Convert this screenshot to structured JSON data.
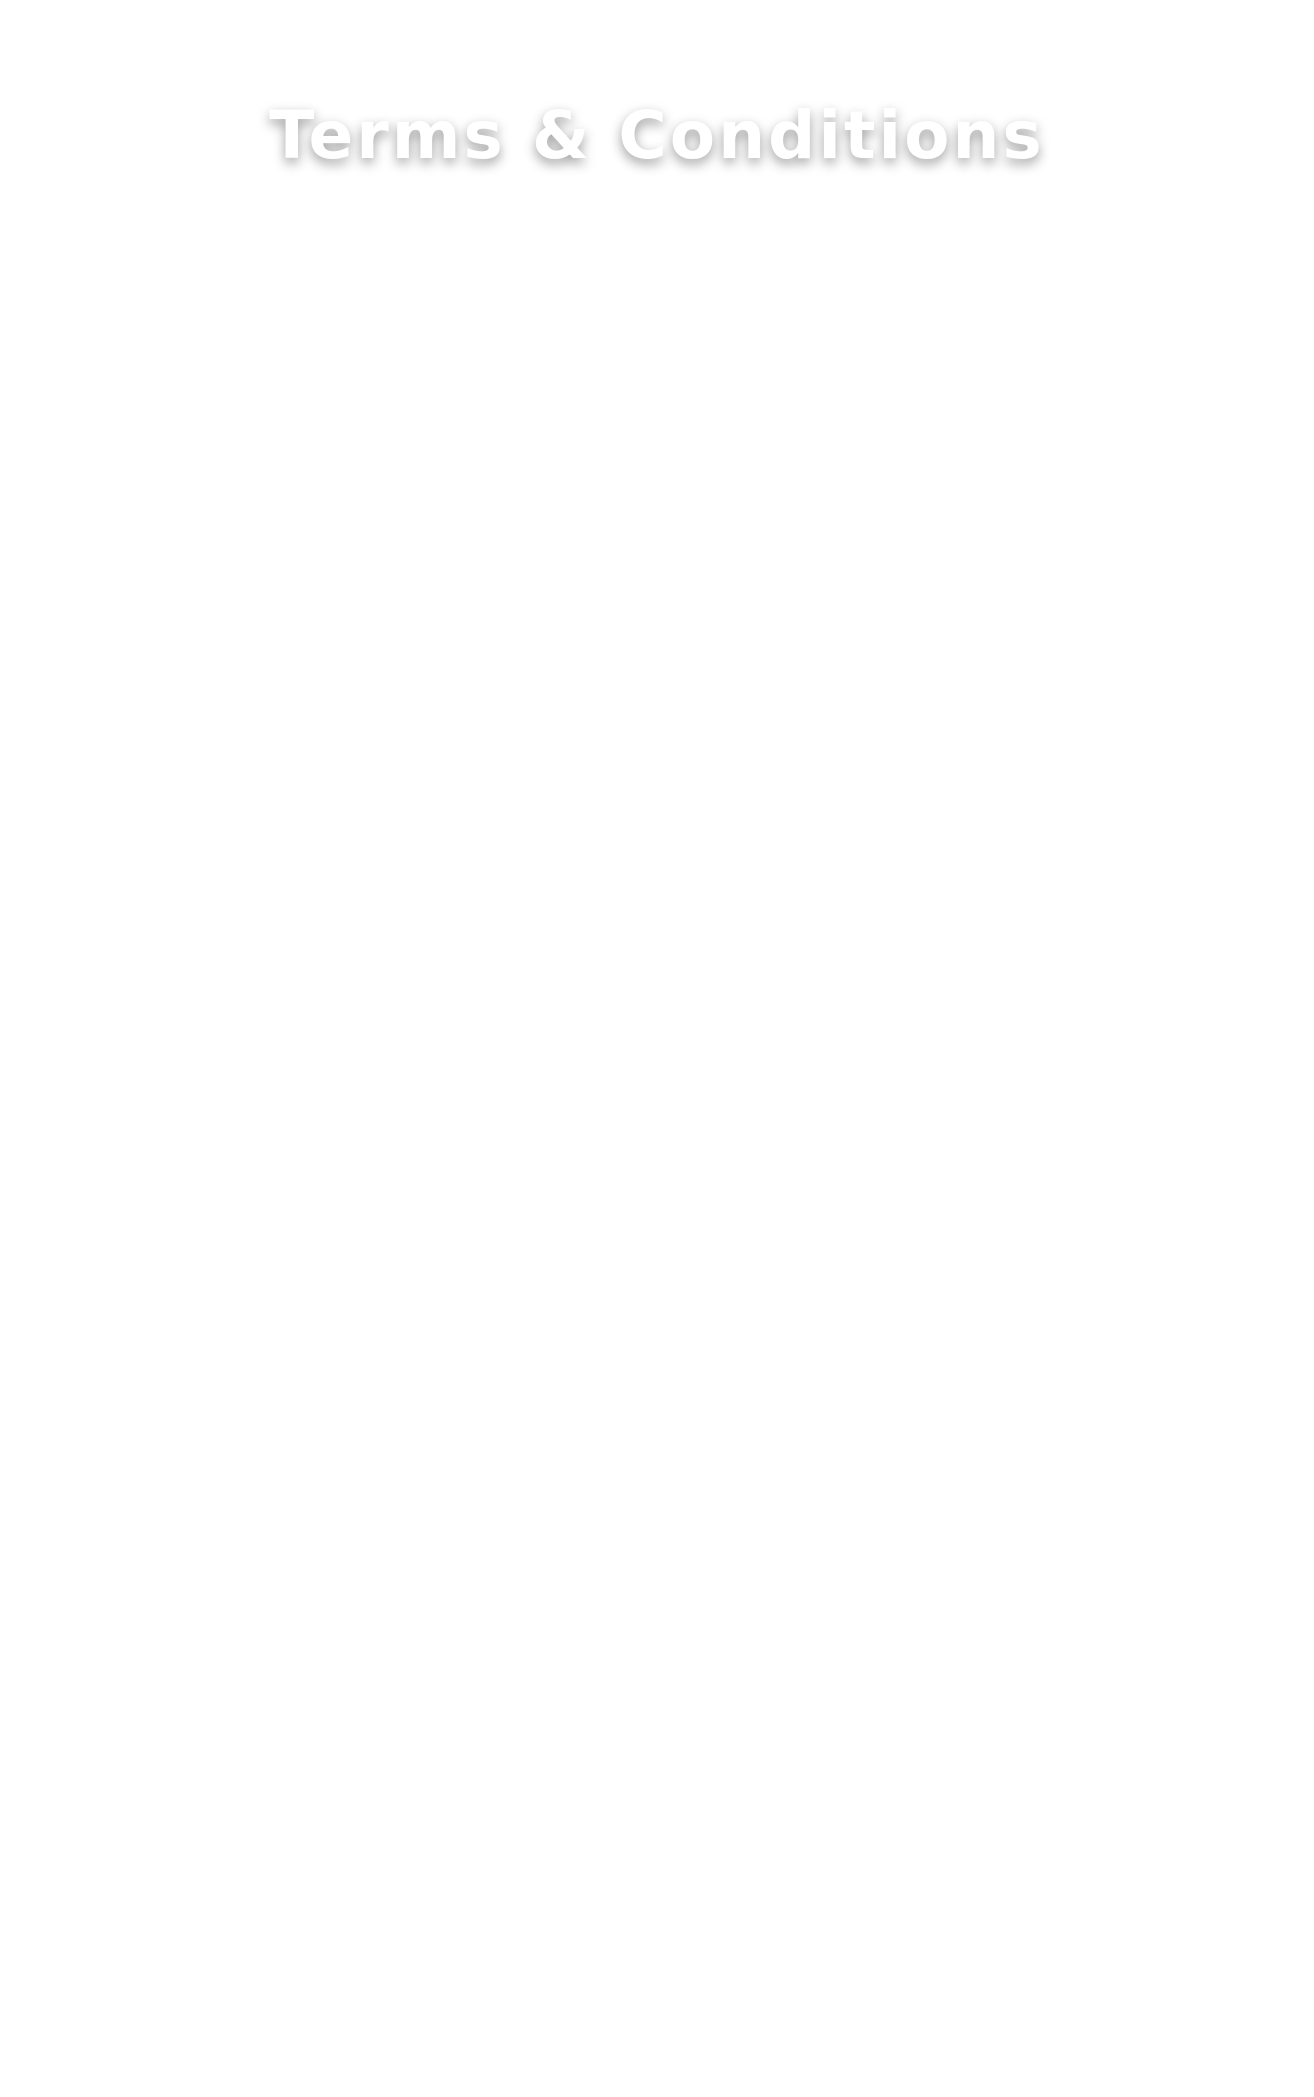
{
  "header": {
    "title": "Terms & Conditions"
  },
  "colors": {
    "background": "#ffffff",
    "title_text": "#ffffff"
  }
}
